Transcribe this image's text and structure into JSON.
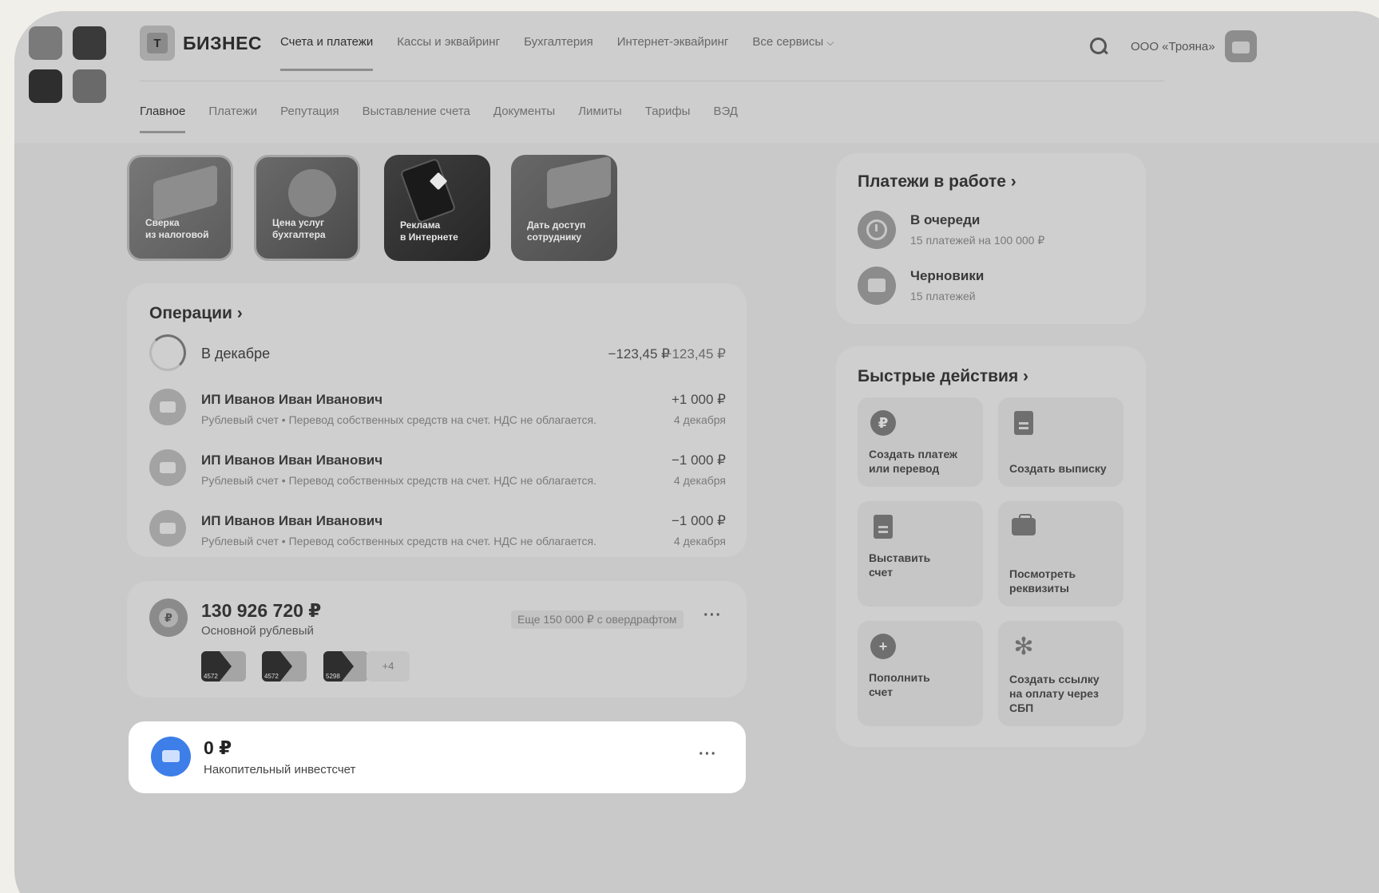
{
  "header": {
    "logo_letter": "Т",
    "logo_text": "БИЗНЕС",
    "nav": [
      "Счета и платежи",
      "Кассы и эквайринг",
      "Бухгалтерия",
      "Интернет-эквайринг",
      "Все сервисы"
    ],
    "org_name": "ООО «Трояна»"
  },
  "subnav": [
    "Главное",
    "Платежи",
    "Репутация",
    "Выставление счета",
    "Документы",
    "Лимиты",
    "Тарифы",
    "ВЭД"
  ],
  "tiles": [
    {
      "label": "Сверка\nиз налоговой"
    },
    {
      "label": "Цена услуг\nбухгалтера"
    },
    {
      "label": "Реклама\nв Интернете"
    },
    {
      "label": "Дать доступ\nсотруднику"
    }
  ],
  "operations": {
    "title": "Операции ›",
    "summary": {
      "label": "В декабре",
      "expense": "−123,45 ₽",
      "income": "+123,45 ₽"
    },
    "rows": [
      {
        "name": "ИП Иванов Иван Иванович",
        "desc": "Рублевый счет • Перевод собственных средств на счет. НДС не облагается.",
        "amount": "+1 000 ₽",
        "date": "4 декабря"
      },
      {
        "name": "ИП Иванов Иван Иванович",
        "desc": "Рублевый счет • Перевод собственных средств на счет. НДС не облагается.",
        "amount": "−1 000 ₽",
        "date": "4 декабря"
      },
      {
        "name": "ИП Иванов Иван Иванович",
        "desc": "Рублевый счет • Перевод собственных средств на счет. НДС не облагается.",
        "amount": "−1 000 ₽",
        "date": "4 декабря"
      }
    ]
  },
  "account": {
    "currency_symbol": "₽",
    "balance": "130 926 720 ₽",
    "name": "Основной рублевый",
    "overdraft": "Еще 150 000 ₽ с овердрафтом",
    "more": "···",
    "cards": [
      "4572",
      "4572",
      "5298"
    ],
    "extra_cards": "+4"
  },
  "invest": {
    "balance": "0 ₽",
    "name": "Накопительный инвестсчет",
    "more": "···"
  },
  "payments_in_work": {
    "title": "Платежи в работе ›",
    "items": [
      {
        "title": "В очереди",
        "sub": "15 платежей на 100 000 ₽"
      },
      {
        "title": "Черновики",
        "sub": "15 платежей"
      }
    ]
  },
  "quick_actions": {
    "title": "Быстрые действия ›",
    "items": [
      {
        "label": "Создать платеж\nили перевод",
        "icon": "ruble-icon"
      },
      {
        "label": "Создать выписку",
        "icon": "document-icon"
      },
      {
        "label": "Выставить\nсчет",
        "icon": "invoice-icon"
      },
      {
        "label": "Посмотреть\nреквизиты",
        "icon": "briefcase-icon"
      },
      {
        "label": "Пополнить\nсчет",
        "icon": "plus-icon"
      },
      {
        "label": "Создать ссылку\nна оплату через\nСБП",
        "icon": "sbp-icon"
      }
    ]
  }
}
